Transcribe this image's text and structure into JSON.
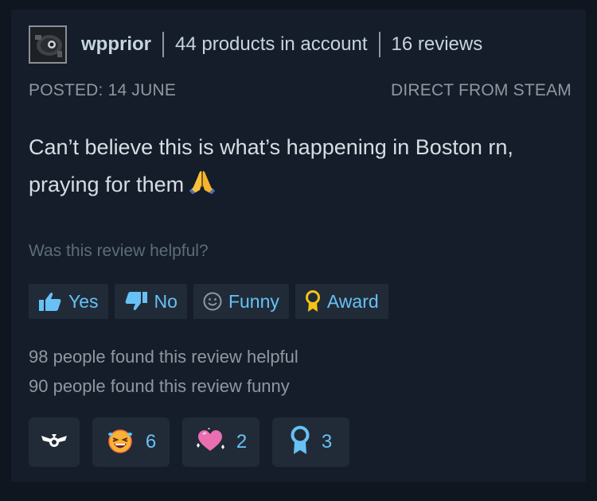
{
  "user": {
    "name": "wpprior",
    "products": "44 products in account",
    "reviews": "16 reviews"
  },
  "review": {
    "posted": "POSTED: 14 JUNE",
    "source": "DIRECT FROM STEAM",
    "text_line1": "Can’t believe this is what’s happening in Boston rn,",
    "text_line2": "praying for them"
  },
  "helpful": {
    "question": "Was this review helpful?",
    "buttons": [
      {
        "label": "Yes",
        "icon": "thumbs-up-icon"
      },
      {
        "label": "No",
        "icon": "thumbs-down-icon"
      },
      {
        "label": "Funny",
        "icon": "smiley-icon"
      },
      {
        "label": "Award",
        "icon": "award-ribbon-icon"
      }
    ]
  },
  "counts": {
    "helpful": "98 people found this review helpful",
    "funny": "90 people found this review funny"
  },
  "reactions": [
    {
      "icon": "winged-award-icon",
      "count": ""
    },
    {
      "icon": "laughing-face-icon",
      "count": "6"
    },
    {
      "icon": "sparkling-heart-icon",
      "count": "2"
    },
    {
      "icon": "award-ribbon-icon",
      "count": "3"
    }
  ],
  "colors": {
    "accent": "#67c1f5",
    "background": "#151d2a",
    "button": "#212b38"
  }
}
